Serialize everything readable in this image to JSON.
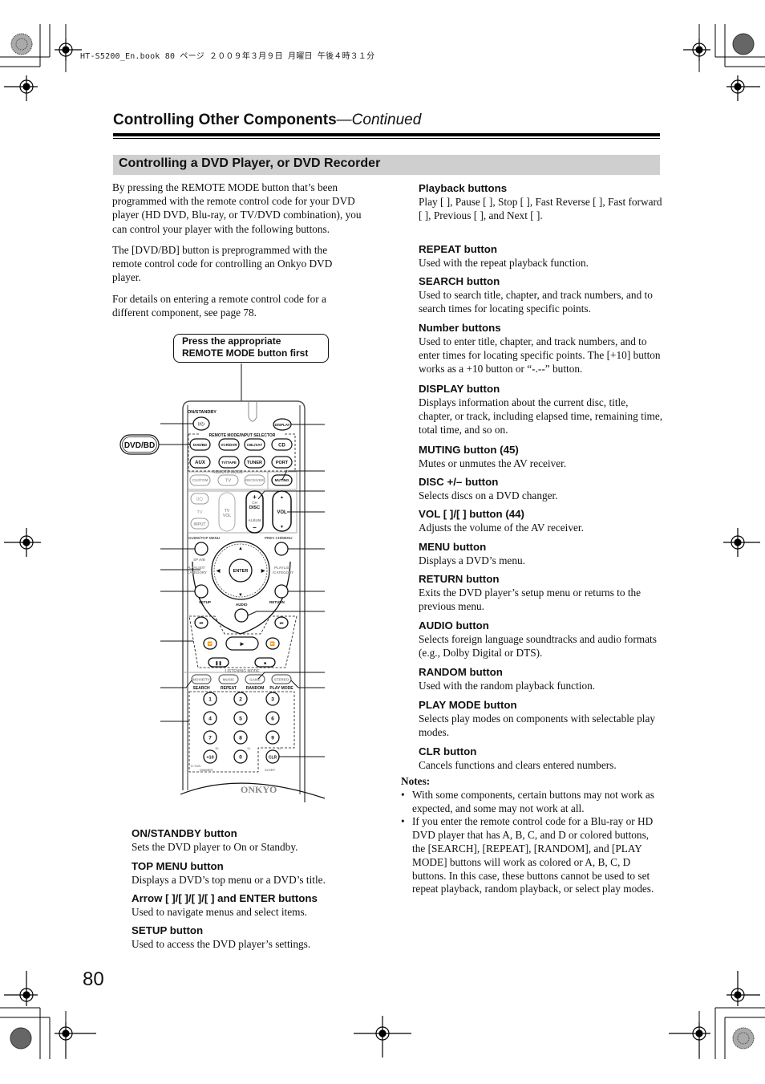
{
  "print_header": "HT-S5200_En.book  80 ページ  ２００９年３月９日  月曜日  午後４時３１分",
  "page": {
    "running_title": "Controlling Other Components",
    "running_title_suffix": "—Continued",
    "section_title": "Controlling a DVD Player, or DVD Recorder",
    "page_number": "80"
  },
  "intro": [
    "By pressing the REMOTE MODE button that’s been programmed with the remote control code for your DVD player (HD DVD, Blu-ray, or TV/DVD combination), you can control your player with the following buttons.",
    "The [DVD/BD] button is preprogrammed with the remote control code for controlling an Onkyo DVD player.",
    "For details on entering a remote control code for a different component, see page 78."
  ],
  "figure": {
    "callout_line1": "Press the appropriate",
    "callout_line2": "REMOTE MODE button first",
    "side_button": "DVD/BD",
    "brand": "ONKYO",
    "labels": {
      "on_standby": "ON/STANDBY",
      "power": "I/⏻",
      "display": "DISPLAY",
      "remote_mode_input_selector": "REMOTE MODE/INPUT SELECTOR",
      "row1": [
        "DVD/BD",
        "VCR/DVR",
        "CBL/SAT",
        "CD"
      ],
      "row2": [
        "AUX",
        "TV/TAPE",
        "TUNER",
        "PORT"
      ],
      "remote_mode": "REMOTE MODE",
      "row3": [
        "CUSTOM",
        "TV",
        "RECEIVER",
        "MUTING"
      ],
      "tv": "TV",
      "input": "INPUT",
      "tv_vol": "TV VOL",
      "ch": "CH",
      "disc": "DISC",
      "album": "ALBUM",
      "vol": "VOL",
      "guide_top_menu": "GUIDE/TOP MENU",
      "prev_ch_menu": "PREV CH/MENU",
      "sp_ab": "SP A/B",
      "playlist_category": "PLAYLIST /CATEGORY",
      "enter": "ENTER",
      "setup": "SETUP",
      "return": "RETURN",
      "audio": "AUDIO",
      "listening_mode": "LISTENING MODE",
      "lm_buttons": [
        "MOVIE/TV",
        "MUSIC",
        "GAME",
        "STEREO"
      ],
      "lm_sub": [
        "SEARCH",
        "REPEAT",
        "RANDOM",
        "PLAY MODE"
      ],
      "digits": [
        "1",
        "2",
        "3",
        "4",
        "5",
        "6",
        "7",
        "8",
        "9",
        "+10",
        "0",
        "CLR"
      ],
      "small_10": "10",
      "small_11": "11",
      "small_12": "12",
      "dtun": "D.TUN",
      "dimmer": "DIMMER",
      "sleep": "SLEEP"
    }
  },
  "left_items": [
    {
      "title": "ON/STANDBY button",
      "desc": "Sets the DVD player to On or Standby."
    },
    {
      "title": "TOP MENU button",
      "desc": "Displays a DVD’s top menu or a DVD’s title."
    },
    {
      "title": "Arrow [   ]/[   ]/[   ]/[   ] and ENTER buttons",
      "desc": "Used to navigate menus and select items."
    },
    {
      "title": "SETUP button",
      "desc": "Used to access the DVD player’s settings."
    }
  ],
  "right_items": [
    {
      "title": "Playback buttons",
      "desc": "Play [      ], Pause [    ], Stop [    ], Fast Reverse [        ], Fast forward [        ], Previous [        ], and Next [        ]."
    },
    {
      "title": "REPEAT button",
      "desc": "Used with the repeat playback function."
    },
    {
      "title": "SEARCH button",
      "desc": "Used to search title, chapter, and track numbers, and to search times for locating specific points."
    },
    {
      "title": "Number buttons",
      "desc": "Used to enter title, chapter, and track numbers, and to enter times for locating specific points. The [+10] button works as a +10 button or “-.--” button."
    },
    {
      "title": "DISPLAY button",
      "desc": "Displays information about the current disc, title, chapter, or track, including elapsed time, remaining time, total time, and so on."
    },
    {
      "title": "MUTING button (45)",
      "desc": "Mutes or unmutes the AV receiver."
    },
    {
      "title": "DISC +/– button",
      "desc": "Selects discs on a DVD changer."
    },
    {
      "title": "VOL [   ]/[   ] button (44)",
      "desc": "Adjusts the volume of the AV receiver."
    },
    {
      "title": "MENU button",
      "desc": "Displays a DVD’s menu."
    },
    {
      "title": "RETURN button",
      "desc": "Exits the DVD player’s setup menu or returns to the previous menu."
    },
    {
      "title": "AUDIO button",
      "desc": "Selects foreign language soundtracks and audio formats (e.g., Dolby Digital or DTS)."
    },
    {
      "title": "RANDOM button",
      "desc": "Used with the random playback function."
    },
    {
      "title": "PLAY MODE button",
      "desc": "Selects play modes on components with selectable play modes."
    },
    {
      "title": "CLR button",
      "desc": "Cancels functions and clears entered numbers."
    }
  ],
  "notes": {
    "heading": "Notes:",
    "items": [
      "With some components, certain buttons may not work as expected, and some may not work at all.",
      "If you enter the remote control code for a Blu-ray or HD DVD player that has A, B, C, and D or colored buttons, the [SEARCH], [REPEAT], [RANDOM], and [PLAY MODE] buttons will work as colored or A, B, C, D buttons. In this case, these buttons cannot be used to set repeat playback, random playback, or select play modes."
    ]
  }
}
